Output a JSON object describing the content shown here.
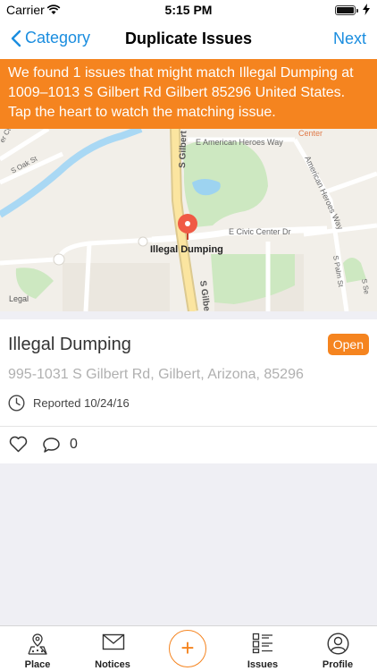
{
  "status_bar": {
    "carrier": "Carrier",
    "time": "5:15 PM",
    "battery_level": 1.0
  },
  "nav": {
    "back_label": "Category",
    "title": "Duplicate Issues",
    "next_label": "Next"
  },
  "banner": {
    "text": "We found 1 issues that might match Illegal Dumping at 1009–1013 S Gilbert Rd Gilbert 85296 United States. Tap the heart to watch the matching issue.",
    "color": "#f5841f"
  },
  "map": {
    "pin_label": "Illegal Dumping",
    "legal_label": "Legal",
    "labels": {
      "center": "Center",
      "e_american_heroes_way": "E American Heroes Way",
      "american_heroes_way": "American Heroes Way",
      "s_gilbert_top": "S Gilbert",
      "s_gilbert_bottom": "S Gilbert",
      "e_civic_center_dr": "E Civic Center Dr",
      "s_oak_st": "S Oak St",
      "s_palm_st": "S Palm St",
      "s_se": "S Se",
      "ct_left": "er Ct"
    }
  },
  "issue": {
    "title": "Illegal Dumping",
    "status": "Open",
    "address": "995-1031 S Gilbert Rd, Gilbert, Arizona, 85296",
    "reported": "Reported 10/24/16",
    "comment_count": "0"
  },
  "tabs": [
    {
      "label": "Place",
      "icon": "place-icon"
    },
    {
      "label": "Notices",
      "icon": "mail-icon"
    },
    {
      "label": "",
      "icon": "plus-icon"
    },
    {
      "label": "Issues",
      "icon": "list-icon"
    },
    {
      "label": "Profile",
      "icon": "profile-icon"
    }
  ],
  "colors": {
    "accent": "#1a8ddf",
    "brand_orange": "#f5841f"
  }
}
